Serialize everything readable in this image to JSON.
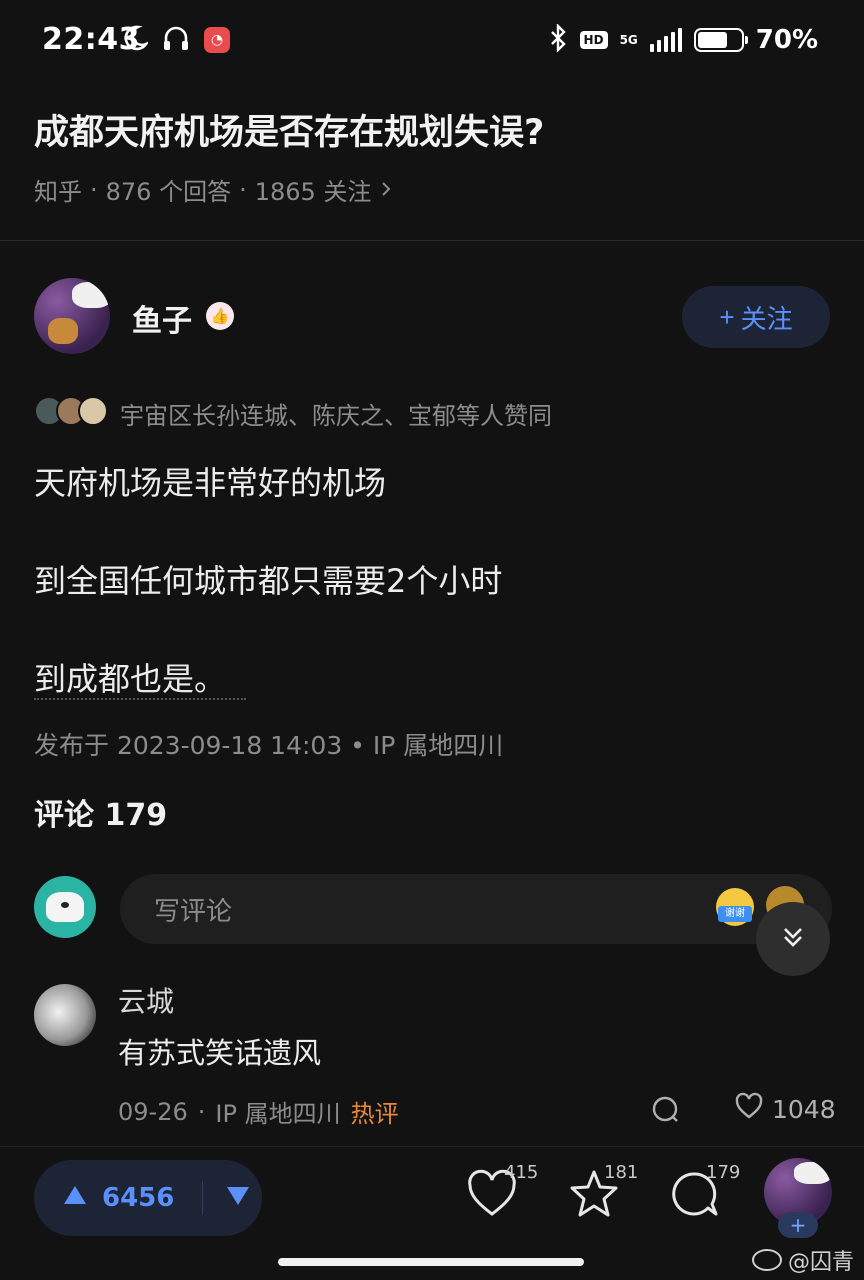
{
  "status_bar": {
    "time": "22:43",
    "network": "5G",
    "hd": "HD",
    "battery_percent": "70%",
    "battery_level": 0.7
  },
  "question": {
    "title": "成都天府机场是否存在规划失误?",
    "source": "知乎",
    "answers": "876 个回答",
    "followers": "1865 关注",
    "sep": "·"
  },
  "author": {
    "name": "鱼子",
    "follow_label": "关注",
    "follow_plus": "+"
  },
  "approval": {
    "text": "宇宙区长孙连城、陈庆之、宝郁等人赞同"
  },
  "answer": {
    "lines": [
      "天府机场是非常好的机场",
      "到全国任何城市都只需要2个小时",
      "到成都也是。"
    ],
    "publish_info": "发布于 2023-09-18 14:03 • IP 属地四川"
  },
  "comments": {
    "header": "评论 179",
    "input_placeholder": "写评论",
    "emoji_tag": "谢谢",
    "items": [
      {
        "user": "云城",
        "text": "有苏式笑话遗风",
        "date": "09-26",
        "sep": "·",
        "ip": "IP 属地四川",
        "tag": "热评",
        "likes": "1048"
      }
    ]
  },
  "bottom_bar": {
    "upvotes": "6456",
    "like_count": "415",
    "favorite_count": "181",
    "comment_count": "179",
    "avatar_plus": "+"
  },
  "watermark": {
    "text": "@囚青"
  },
  "colors": {
    "background": "#121212",
    "accent_blue": "#5b8ff9",
    "hot_orange": "#e8873a",
    "muted_text": "#8c8c8c"
  }
}
